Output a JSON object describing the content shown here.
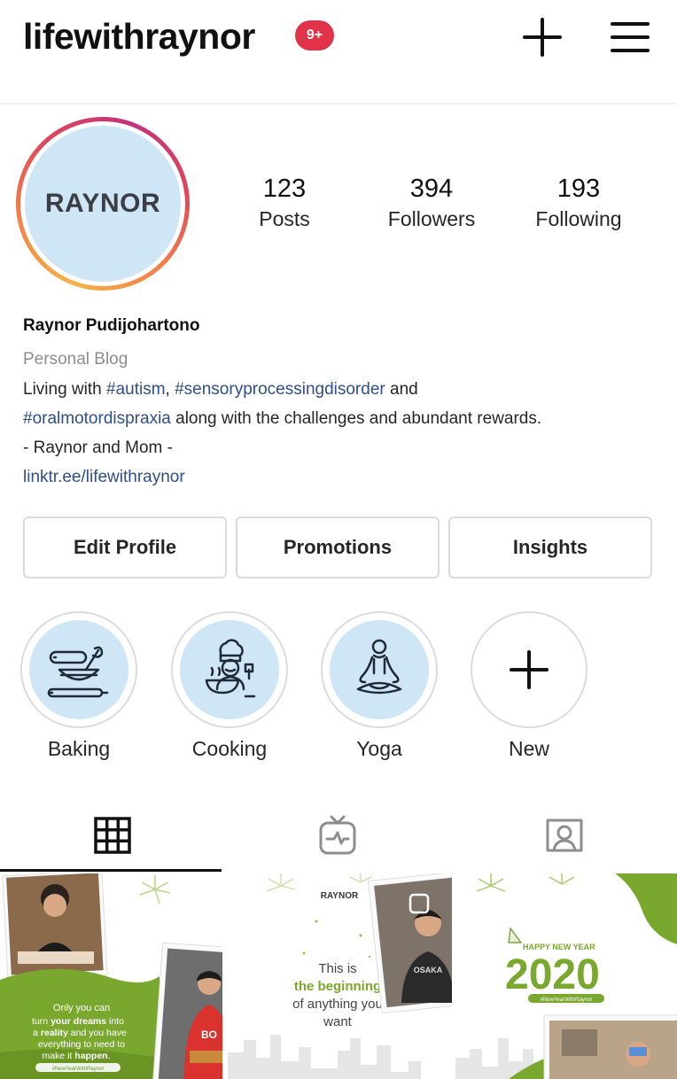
{
  "header": {
    "username": "lifewithraynor",
    "notification_badge": "9+",
    "icons": [
      "plus-icon",
      "menu-icon"
    ]
  },
  "profile": {
    "avatar_text": "RAYNOR",
    "stats": [
      {
        "number": "123",
        "label": "Posts"
      },
      {
        "number": "394",
        "label": "Followers"
      },
      {
        "number": "193",
        "label": "Following"
      }
    ]
  },
  "bio": {
    "name": "Raynor Pudijohartono",
    "category": "Personal Blog",
    "line1_prefix": "Living with ",
    "tag_autism": "#autism",
    "line1_sep": ", ",
    "tag_spd": "#sensoryprocessingdisorder",
    "line1_suffix": " and",
    "tag_omd": "#oralmotordispraxia",
    "line2_suffix": " along with the challenges and abundant rewards.",
    "line3": "- Raynor and Mom -",
    "link": "linktr.ee/lifewithraynor"
  },
  "buttons": {
    "edit_profile": "Edit Profile",
    "promotions": "Promotions",
    "insights": "Insights"
  },
  "highlights": [
    {
      "label": "Baking",
      "icon": "baking-icon"
    },
    {
      "label": "Cooking",
      "icon": "chef-icon"
    },
    {
      "label": "Yoga",
      "icon": "yoga-icon"
    },
    {
      "label": "New",
      "icon": "plus-icon"
    }
  ],
  "tabs": [
    {
      "name": "grid",
      "icon": "grid-icon",
      "active": true
    },
    {
      "name": "igtv",
      "icon": "igtv-icon",
      "active": false
    },
    {
      "name": "tagged",
      "icon": "tagged-icon",
      "active": false
    }
  ],
  "posts": {
    "post1": {
      "line1": "Only you can",
      "line2_a": "turn ",
      "line2_b": "your dreams",
      "line2_c": " into",
      "line3_a": "a ",
      "line3_b": "reality",
      "line3_c": " and you have",
      "line4": "everything to need to",
      "line5_a": "make it ",
      "line5_b": "happen",
      "line5_c": ".",
      "hashtag": "#NewYearWithRaynor",
      "shirt": "BO"
    },
    "post2": {
      "brand": "RAYNOR",
      "line1": "This is",
      "line2": "the beginning",
      "line3": "of anything you",
      "line4": "want",
      "shirt": "OSAKA"
    },
    "post3": {
      "greeting": "HAPPY NEW YEAR",
      "year": "2020",
      "hashtag": "#NewYearWithRaynor"
    }
  },
  "colors": {
    "badge": "#e0334a",
    "link": "#2f4f86",
    "highlight_bg": "#cfe6f7",
    "post_green": "#7aa72e"
  }
}
